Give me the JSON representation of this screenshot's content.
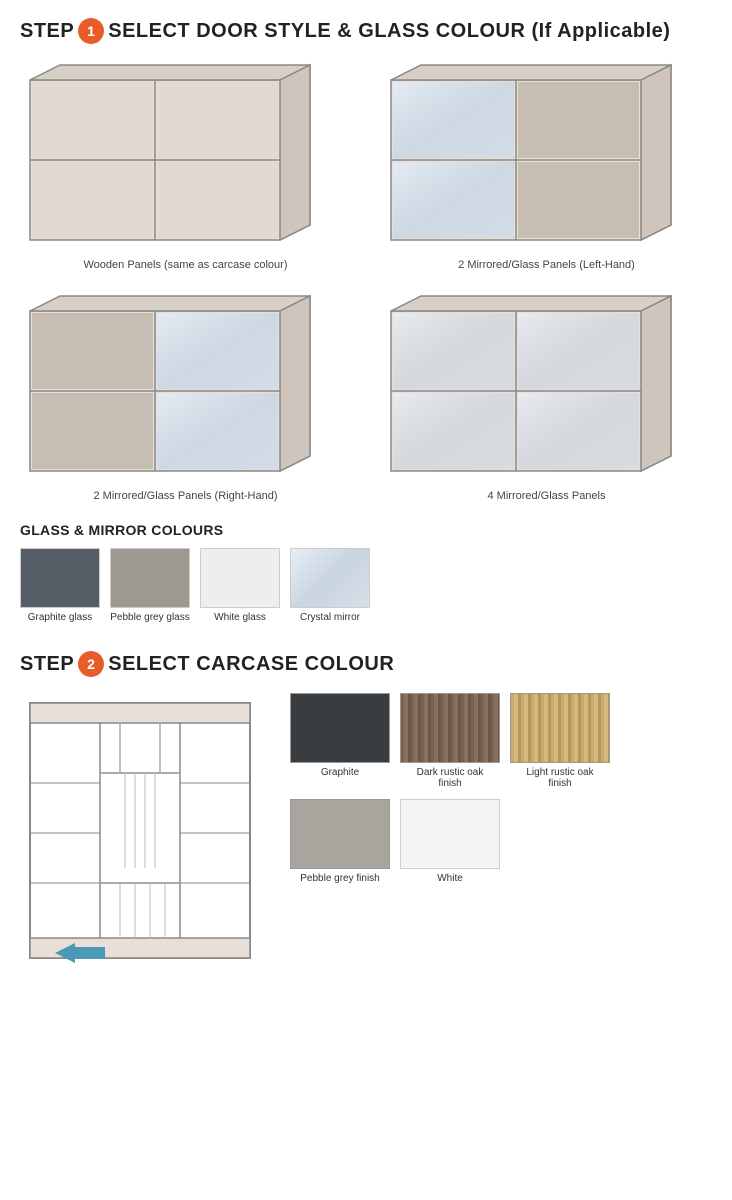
{
  "step1": {
    "heading_pre": "STEP",
    "heading_num": "1",
    "heading_post": "SELECT DOOR STYLE & GLASS COLOUR (If Applicable)"
  },
  "door_options": [
    {
      "id": "wooden-panels",
      "label": "Wooden Panels (same as carcase colour)"
    },
    {
      "id": "mirror-left",
      "label": "2 Mirrored/Glass Panels (Left-Hand)"
    },
    {
      "id": "mirror-right",
      "label": "2 Mirrored/Glass Panels (Right-Hand)"
    },
    {
      "id": "mirror-4",
      "label": "4 Mirrored/Glass Panels"
    }
  ],
  "glass_section_title": "GLASS & MIRROR COLOURS",
  "glass_colours": [
    {
      "id": "graphite-glass",
      "label": "Graphite glass",
      "color": "#555d66"
    },
    {
      "id": "pebble-grey-glass",
      "label": "Pebble grey glass",
      "color": "#9e9990"
    },
    {
      "id": "white-glass",
      "label": "White glass",
      "color": "#f0eeec"
    },
    {
      "id": "crystal-mirror",
      "label": "Crystal mirror",
      "color": "#d8dfe8",
      "sheen": true
    }
  ],
  "step2": {
    "heading_pre": "STEP",
    "heading_num": "2",
    "heading_post": "SELECT CARCASE COLOUR"
  },
  "carcase_colours": [
    {
      "id": "graphite",
      "label": "Graphite",
      "color": "#3a3d40",
      "row": 0
    },
    {
      "id": "dark-rustic-oak",
      "label": "Dark rustic oak finish",
      "color": "#7a6251",
      "texture": true,
      "row": 0
    },
    {
      "id": "light-rustic-oak",
      "label": "Light rustic oak finish",
      "color": "#c9a96e",
      "texture": true,
      "row": 0
    },
    {
      "id": "pebble-grey-finish",
      "label": "Pebble grey finish",
      "color": "#a8a49e",
      "row": 1
    },
    {
      "id": "white",
      "label": "White",
      "color": "#f5f4f2",
      "row": 1
    }
  ]
}
